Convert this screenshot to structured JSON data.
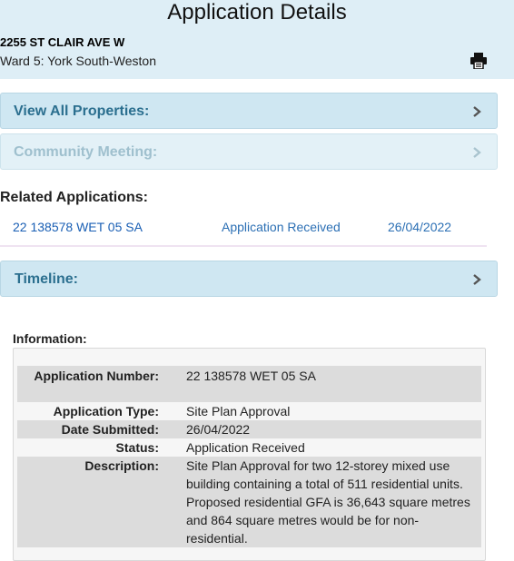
{
  "header": {
    "title": "Application Details",
    "address": "2255 ST CLAIR AVE W",
    "ward": "Ward 5: York South-Weston",
    "print_icon": "printer-icon"
  },
  "panels": {
    "view_all": "View All Properties:",
    "community": "Community Meeting:",
    "timeline": "Timeline:"
  },
  "related": {
    "heading": "Related Applications:",
    "rows": [
      {
        "number": "22 138578 WET 05 SA",
        "status": "Application Received",
        "date": "26/04/2022"
      }
    ]
  },
  "information": {
    "heading": "Information:",
    "fields": {
      "app_number_label": "Application Number:",
      "app_number": "22 138578 WET 05 SA",
      "app_type_label": "Application Type:",
      "app_type": "Site Plan Approval",
      "date_label": "Date Submitted:",
      "date": "26/04/2022",
      "status_label": "Status:",
      "status": "Application Received",
      "description_label": "Description:",
      "description": "Site Plan Approval for two 12-storey mixed use building containing a total of 511 residential units. Proposed residential GFA is 36,643 square metres and 864 square metres would be for non-residential."
    }
  },
  "colors": {
    "header_bg": "#deeef6",
    "panel_bg": "#cfe7f2",
    "panel_text": "#2b6f8f",
    "link": "#1a5fb4"
  }
}
